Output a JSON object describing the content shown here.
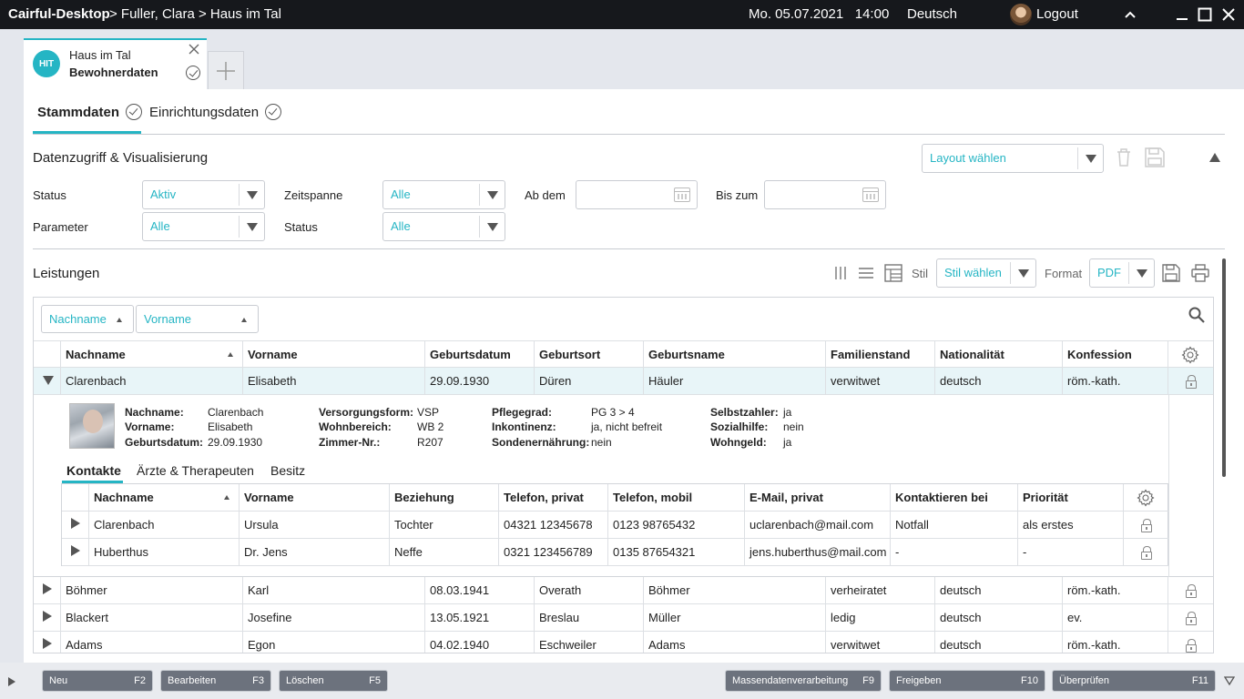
{
  "titlebar": {
    "app": "Cairful-Desktop",
    "breadcrumb": " > Fuller, Clara > Haus im Tal",
    "datetime": "Mo. 05.07.2021   14:00",
    "language": "Deutsch",
    "logout": "Logout"
  },
  "tab": {
    "logo": "HIT",
    "title": "Haus im Tal",
    "subtitle": "Bewohnerdaten"
  },
  "subtabs": [
    "Stammdaten",
    "Einrichtungsdaten"
  ],
  "filter": {
    "section_title": "Datenzugriff & Visualisierung",
    "layout_select": "Layout wählen",
    "status_label": "Status",
    "status_value": "Aktiv",
    "zeitspanne_label": "Zeitspanne",
    "zeitspanne_value": "Alle",
    "abdem_label": "Ab dem",
    "biszum_label": "Bis zum",
    "parameter_label": "Parameter",
    "parameter_value": "Alle",
    "status2_label": "Status",
    "status2_value": "Alle"
  },
  "leistungen": {
    "title": "Leistungen",
    "stil_label": "Stil",
    "stil_value": "Stil wählen",
    "format_label": "Format",
    "format_value": "PDF"
  },
  "group_chips": [
    "Nachname",
    "Vorname"
  ],
  "columns": [
    "Nachname",
    "Vorname",
    "Geburtsdatum",
    "Geburtsort",
    "Geburtsname",
    "Familienstand",
    "Nationalität",
    "Konfession"
  ],
  "rows": [
    [
      "Clarenbach",
      "Elisabeth",
      "29.09.1930",
      "Düren",
      "Häuler",
      "verwitwet",
      "deutsch",
      "röm.-kath."
    ],
    [
      "Böhmer",
      "Karl",
      "08.03.1941",
      "Overath",
      "Böhmer",
      "verheiratet",
      "deutsch",
      "röm.-kath."
    ],
    [
      "Blackert",
      "Josefine",
      "13.05.1921",
      "Breslau",
      "Müller",
      "ledig",
      "deutsch",
      "ev."
    ],
    [
      "Adams",
      "Egon",
      "04.02.1940",
      "Eschweiler",
      "Adams",
      "verwitwet",
      "deutsch",
      "röm.-kath."
    ]
  ],
  "detail": {
    "nachname_l": "Nachname:",
    "nachname_v": "Clarenbach",
    "vorname_l": "Vorname:",
    "vorname_v": "Elisabeth",
    "geburt_l": "Geburtsdatum:",
    "geburt_v": "29.09.1930",
    "versorgung_l": "Versorgungsform:",
    "versorgung_v": "VSP",
    "wohnbereich_l": "Wohnbereich:",
    "wohnbereich_v": "WB 2",
    "zimmer_l": "Zimmer-Nr.:",
    "zimmer_v": "R207",
    "pflegegrad_l": "Pflegegrad:",
    "pflegegrad_v": "PG 3 > 4",
    "inkontinenz_l": "Inkontinenz:",
    "inkontinenz_v": "ja, nicht befreit",
    "sonden_l": "Sondenernährung:",
    "sonden_v": "nein",
    "selbst_l": "Selbstzahler:",
    "selbst_v": "ja",
    "sozial_l": "Sozialhilfe:",
    "sozial_v": "nein",
    "wohngeld_l": "Wohngeld:",
    "wohngeld_v": "ja"
  },
  "detail_tabs": [
    "Kontakte",
    "Ärzte & Therapeuten",
    "Besitz"
  ],
  "contact_columns": [
    "Nachname",
    "Vorname",
    "Beziehung",
    "Telefon, privat",
    "Telefon, mobil",
    "E-Mail, privat",
    "Kontaktieren bei",
    "Priorität"
  ],
  "contacts": [
    [
      "Clarenbach",
      "Ursula",
      "Tochter",
      "04321 12345678",
      "0123 98765432",
      "uclarenbach@mail.com",
      "Notfall",
      "als erstes"
    ],
    [
      "Huberthus",
      "Dr. Jens",
      "Neffe",
      "0321 123456789",
      "0135 87654321",
      "jens.huberthus@mail.com",
      "-",
      "-"
    ]
  ],
  "fkeys": [
    {
      "label": "Neu",
      "key": "F2"
    },
    {
      "label": "Bearbeiten",
      "key": "F3"
    },
    {
      "label": "Löschen",
      "key": "F5"
    },
    {
      "label": "Massendatenverarbeitung",
      "key": "F9"
    },
    {
      "label": "Freigeben",
      "key": "F10"
    },
    {
      "label": "Überprüfen",
      "key": "F11"
    }
  ],
  "colors": {
    "accent": "#25b5c4",
    "titlebar": "#16181c",
    "fkey": "#6c727d"
  }
}
